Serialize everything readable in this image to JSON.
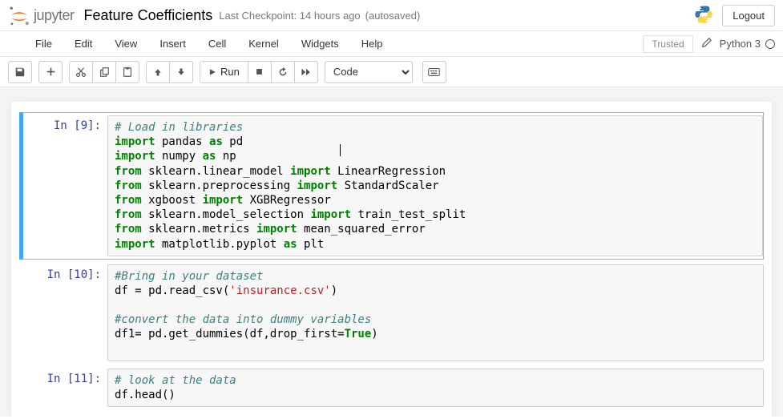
{
  "header": {
    "logo_text": "jupyter",
    "notebook_name": "Feature Coefficients",
    "checkpoint": "Last Checkpoint: 14 hours ago",
    "autosaved": "(autosaved)",
    "logout": "Logout"
  },
  "menubar": {
    "items": [
      "File",
      "Edit",
      "View",
      "Insert",
      "Cell",
      "Kernel",
      "Widgets",
      "Help"
    ],
    "trusted": "Trusted",
    "kernel": "Python 3"
  },
  "toolbar": {
    "run_label": "Run",
    "cell_type": "Code"
  },
  "cells": [
    {
      "prompt": "In [9]:",
      "selected": true,
      "code_html": "<span class='c'># Load in libraries</span>\n<span class='kw'>import</span> pandas <span class='kw'>as</span> pd\n<span class='kw'>import</span> numpy <span class='kw'>as</span> np\n<span class='kw'>from</span> sklearn.linear_model <span class='kw'>import</span> LinearRegression\n<span class='kw'>from</span> sklearn.preprocessing <span class='kw'>import</span> StandardScaler\n<span class='kw'>from</span> xgboost <span class='kw'>import</span> XGBRegressor\n<span class='kw'>from</span> sklearn.model_selection <span class='kw'>import</span> train_test_split\n<span class='kw'>from</span> sklearn.metrics <span class='kw'>import</span> mean_squared_error\n<span class='kw'>import</span> matplotlib.pyplot <span class='kw'>as</span> plt"
    },
    {
      "prompt": "In [10]:",
      "selected": false,
      "code_html": "<span class='c'>#Bring in your dataset</span>\ndf = pd.read_csv(<span class='str'>'insurance.csv'</span>)\n\n<span class='c'>#convert the data into dummy variables</span>\ndf1= pd.get_dummies(df,drop_first=<span class='bool'>True</span>)\n\n"
    },
    {
      "prompt": "In [11]:",
      "selected": false,
      "code_html": "<span class='c'># look at the data</span>\ndf.head()"
    }
  ]
}
